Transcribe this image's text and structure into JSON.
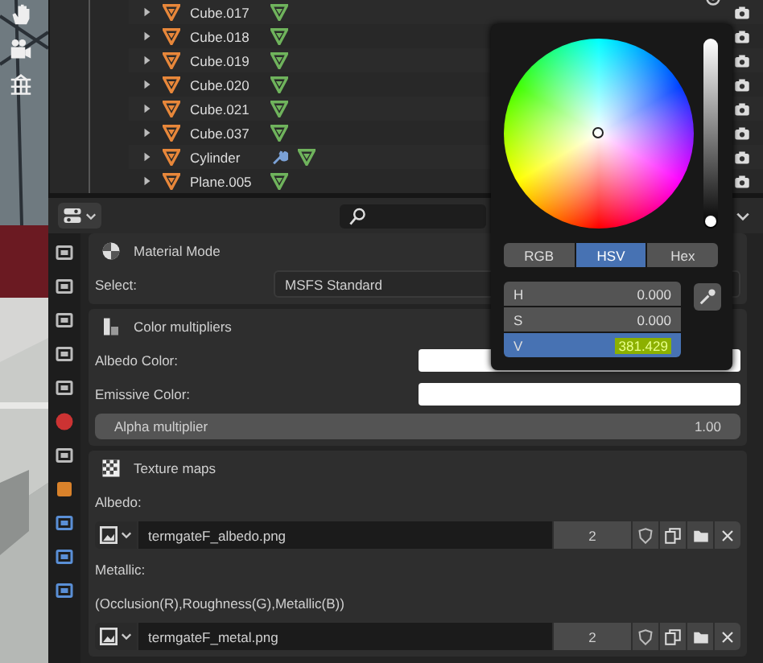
{
  "outliner": {
    "rows": [
      {
        "name": "Cube.017",
        "expanded": false,
        "has_modifier": false
      },
      {
        "name": "Cube.018",
        "expanded": false,
        "has_modifier": false
      },
      {
        "name": "Cube.019",
        "expanded": false,
        "has_modifier": false
      },
      {
        "name": "Cube.020",
        "expanded": false,
        "has_modifier": false
      },
      {
        "name": "Cube.021",
        "expanded": false,
        "has_modifier": false
      },
      {
        "name": "Cube.037",
        "expanded": false,
        "has_modifier": false
      },
      {
        "name": "Cylinder",
        "expanded": false,
        "has_modifier": true
      },
      {
        "name": "Plane.005",
        "expanded": false,
        "has_modifier": false
      }
    ]
  },
  "material_mode": {
    "title": "Material Mode",
    "select_label": "Select:",
    "select_value": "MSFS Standard"
  },
  "color_multipliers": {
    "title": "Color multipliers",
    "fields": [
      {
        "label": "Albedo Color:"
      },
      {
        "label": "Emissive Color:"
      }
    ],
    "alpha": {
      "label": "Alpha multiplier",
      "value": "1.00"
    }
  },
  "texture_maps": {
    "title": "Texture maps",
    "maps": [
      {
        "label": "Albedo:",
        "file": "termgateF_albedo.png",
        "users": "2"
      },
      {
        "label": "Metallic:",
        "note": "(Occlusion(R),Roughness(G),Metallic(B))",
        "file": "termgateF_metal.png",
        "users": "2"
      }
    ]
  },
  "color_picker": {
    "value_slider": {
      "level": 0
    },
    "modes": [
      {
        "label": "RGB",
        "selected": false
      },
      {
        "label": "HSV",
        "selected": true
      },
      {
        "label": "Hex",
        "selected": false
      }
    ],
    "fields": [
      {
        "label": "H",
        "value": "0.000",
        "selected": false
      },
      {
        "label": "S",
        "value": "0.000",
        "selected": false
      },
      {
        "label": "V",
        "value": "381.429",
        "selected": true
      }
    ]
  }
}
